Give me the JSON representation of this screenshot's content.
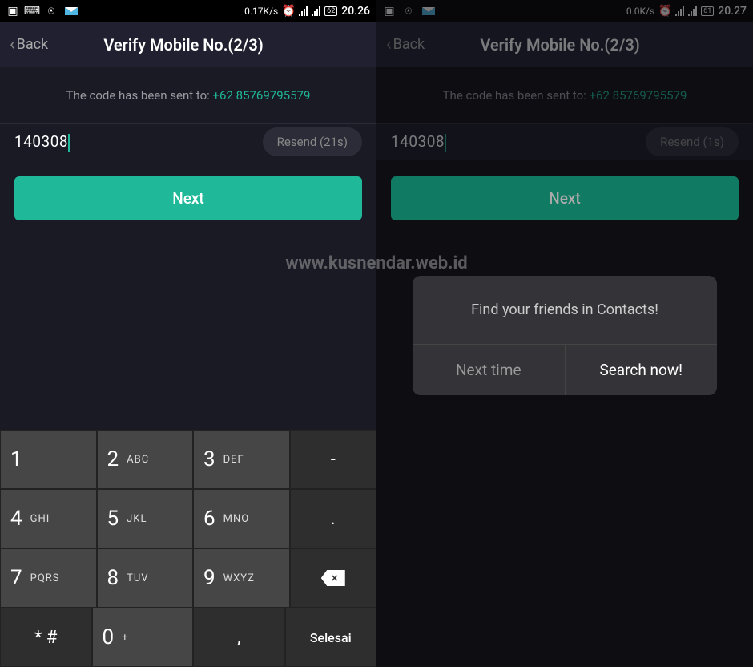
{
  "watermark": "www.kusnendar.web.id",
  "left": {
    "status": {
      "speed": "0.17K/s",
      "battery": "62",
      "time": "20.26"
    },
    "header": {
      "back": "Back",
      "title": "Verify Mobile No.(2/3)"
    },
    "sent_prefix": "The code has been sent to: ",
    "phone": "+62 85769795579",
    "code_value": "140308",
    "resend": "Resend  (21s)",
    "next": "Next",
    "keys": {
      "r1": [
        {
          "d": "1",
          "l": ""
        },
        {
          "d": "2",
          "l": "ABC"
        },
        {
          "d": "3",
          "l": "DEF"
        }
      ],
      "r2": [
        {
          "d": "4",
          "l": "GHI"
        },
        {
          "d": "5",
          "l": "JKL"
        },
        {
          "d": "6",
          "l": "MNO"
        }
      ],
      "r3": [
        {
          "d": "7",
          "l": "PQRS"
        },
        {
          "d": "8",
          "l": "TUV"
        },
        {
          "d": "9",
          "l": "WXYZ"
        }
      ],
      "r4": {
        "star": "* #",
        "zero": "0",
        "plus": "+",
        "done": "Selesai"
      },
      "side": {
        "dash": "-",
        "dot": ".",
        "comma": ","
      }
    }
  },
  "right": {
    "status": {
      "speed": "0.0K/s",
      "battery": "61",
      "time": "20.27"
    },
    "header": {
      "back": "Back",
      "title": "Verify Mobile No.(2/3)"
    },
    "sent_prefix": "The code has been sent to: ",
    "phone": "+62 85769795579",
    "code_value": "140308",
    "resend": "Resend  (1s)",
    "next": "Next",
    "dialog": {
      "message": "Find your friends in Contacts!",
      "secondary": "Next time",
      "primary": "Search now!"
    }
  }
}
